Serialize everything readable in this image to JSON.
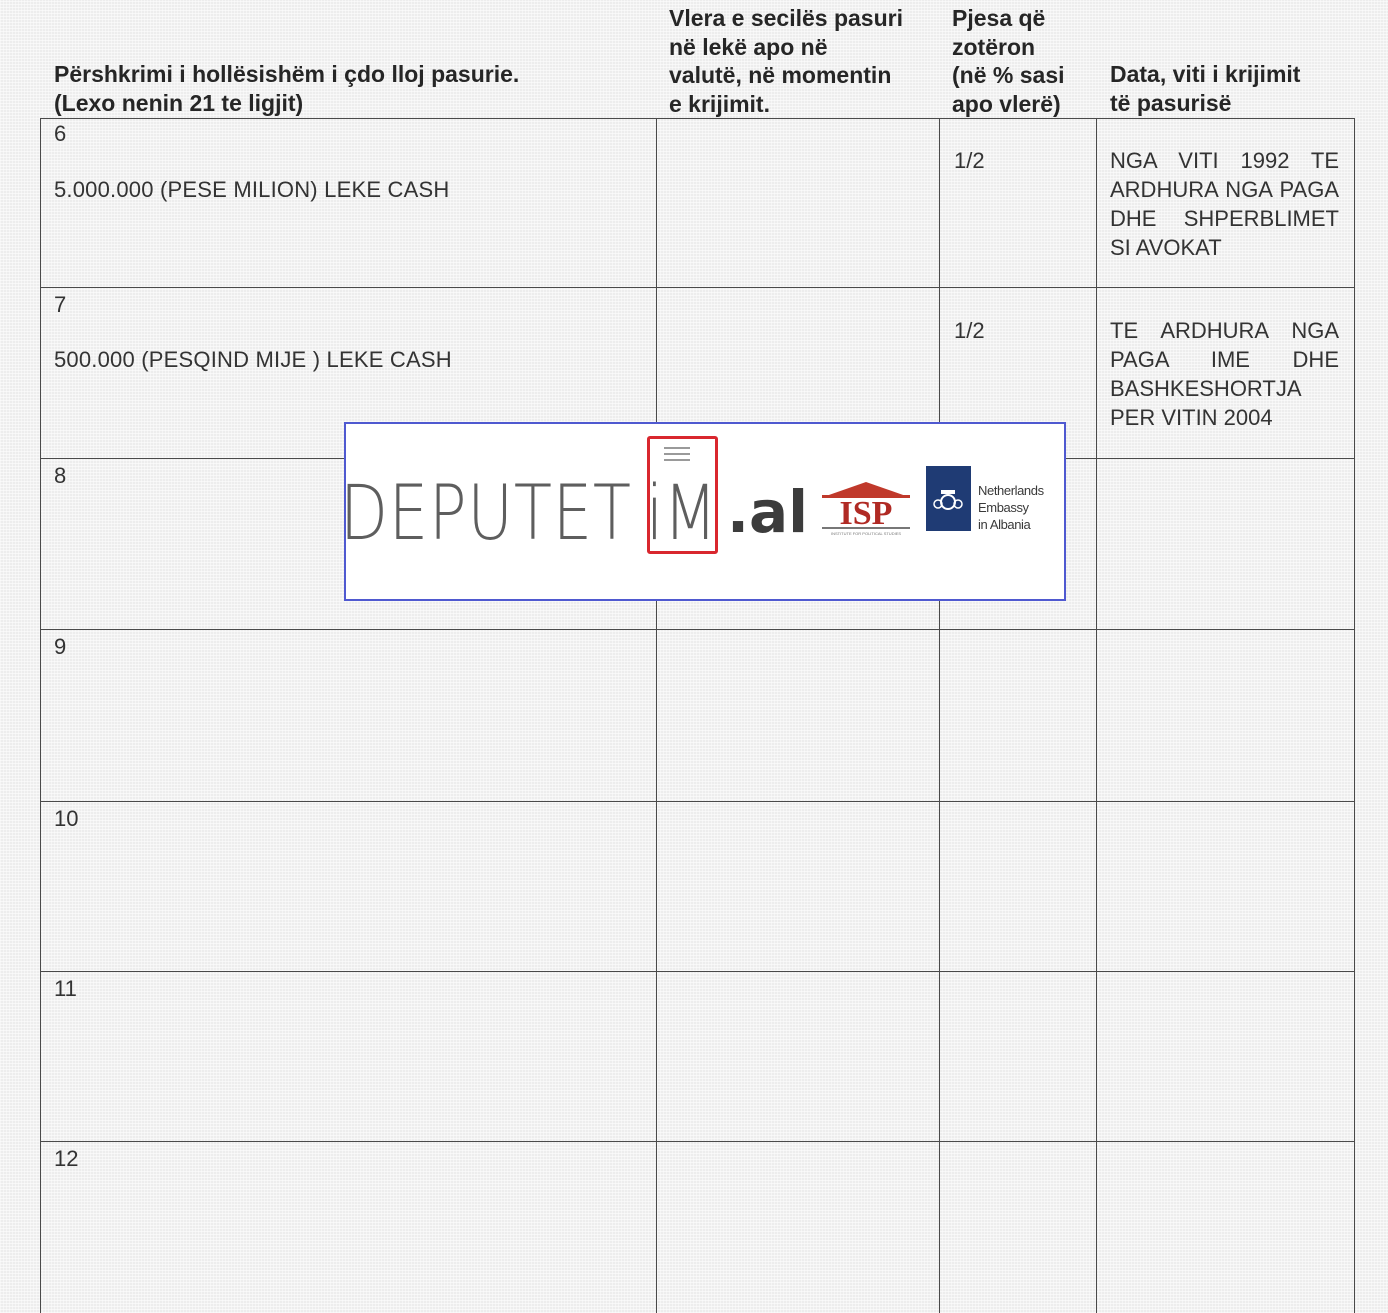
{
  "header": {
    "col1": "Përshkrimi i hollësishëm i çdo lloj pasurie.\n (Lexo nenin 21 te ligjit)",
    "col2": "Vlera e secilës pasuri\nnë lekë apo në\nvalutë, në momentin\ne krijimit.",
    "col3": "Pjesa që\nzotëron\n(në % sasi\napo vlerë)",
    "col4": "Data, viti i krijimit\ntë pasurisë"
  },
  "rows": [
    {
      "num": "6",
      "description": "5.000.000 (PESE MILION) LEKE CASH",
      "value": "",
      "share": "1/2",
      "date": "NGA VITI 1992 TE ARDHURA NGA PAGA DHE SHPERBLIMET SI AVOKAT"
    },
    {
      "num": "7",
      "description": "500.000 (PESQIND MIJE ) LEKE CASH",
      "value": "",
      "share": "1/2",
      "date": "TE ARDHURA NGA PAGA IME DHE BASHKESHORTJA PER VITIN 2004"
    },
    {
      "num": "8",
      "description": "",
      "value": "",
      "share": "",
      "date": ""
    },
    {
      "num": "9",
      "description": "",
      "value": "",
      "share": "",
      "date": ""
    },
    {
      "num": "10",
      "description": "",
      "value": "",
      "share": "",
      "date": ""
    },
    {
      "num": "11",
      "description": "",
      "value": "",
      "share": "",
      "date": ""
    },
    {
      "num": "12",
      "description": "",
      "value": "",
      "share": "",
      "date": ""
    }
  ],
  "banner": {
    "logo_text": "DEPUTET",
    "logo_im": "iM",
    "logo_suffix": ".al",
    "isp_logo": "ISP",
    "isp_caption": "INSTITUTE FOR POLITICAL STUDIES",
    "embassy_line1": "Netherlands",
    "embassy_line2": "Embassy",
    "embassy_line3": "in Albania",
    "border_color": "#4f59d0",
    "accent_color": "#d9272e",
    "embassy_color": "#1f3b74"
  }
}
